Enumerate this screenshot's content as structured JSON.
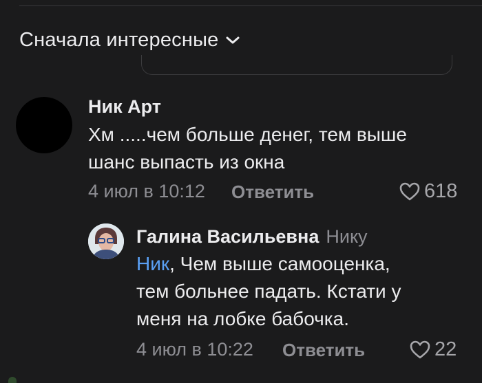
{
  "sort": {
    "label": "Сначала интересные",
    "icon": "chevron-down-icon"
  },
  "comments": [
    {
      "author": "Ник Арт",
      "text_lines": [
        "Хм .....чем больше денег, тем выше",
        "шанс выпасть из окна"
      ],
      "time": "4 июл в 10:12",
      "reply_label": "Ответить",
      "likes": "618",
      "avatar_color": "#000000"
    }
  ],
  "reply": {
    "author": "Галина Васильевна",
    "reply_to": "Нику",
    "mention": "Ник",
    "text_lines": [
      ", Чем выше самооценка,",
      "тем больнее падать. Кстати у",
      "меня на лобке бабочка."
    ],
    "time": "4 июл в 10:22",
    "reply_label": "Ответить",
    "likes": "22"
  },
  "colors": {
    "background": "#1b1b1c",
    "text": "#ececee",
    "meta": "#8e8e93",
    "mention": "#5aa0f5"
  }
}
